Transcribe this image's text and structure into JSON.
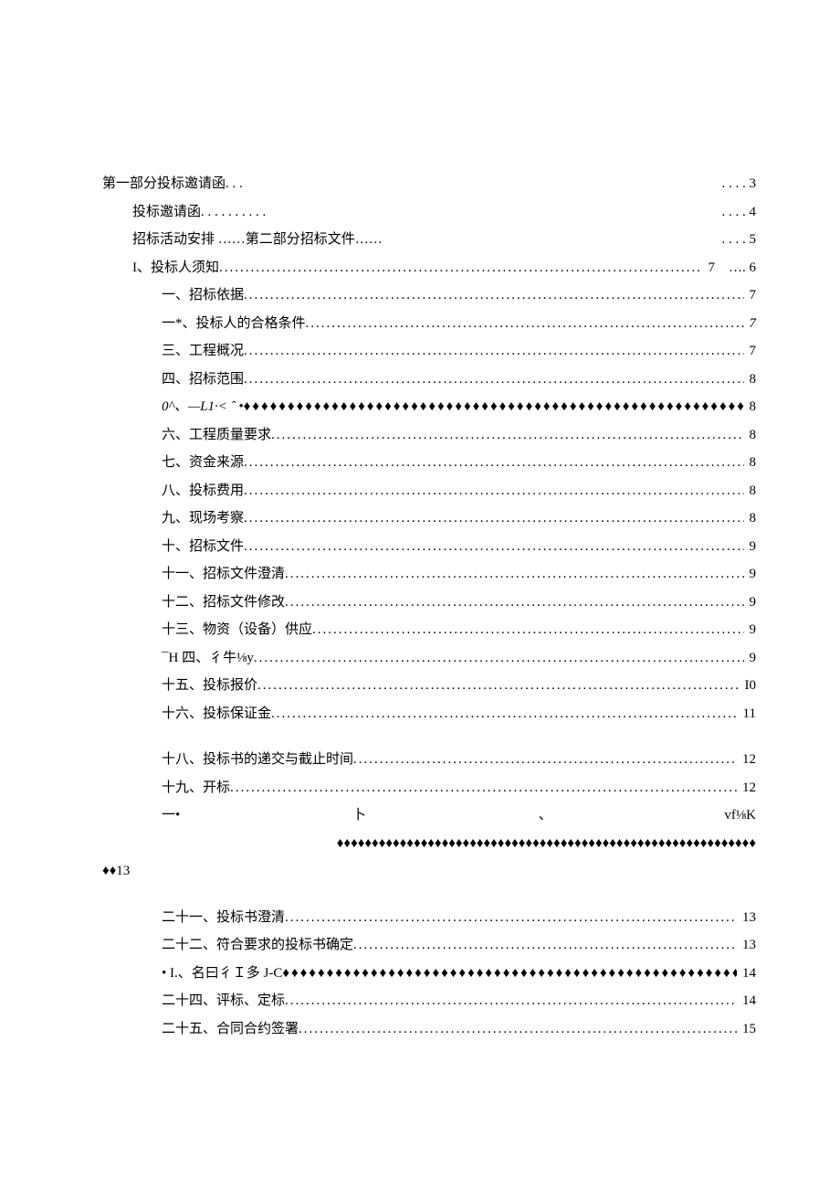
{
  "toc": [
    {
      "indent": 0,
      "label": "第一部分投标邀请函. . .",
      "leader": "",
      "page": ". . . . 3"
    },
    {
      "indent": 1,
      "label": "投标邀请函. . . . . . . . . .",
      "leader": "",
      "page": ". . . . 4"
    },
    {
      "indent": 1,
      "label": "招标活动安排 ……第二部分招标文件……",
      "leader": "",
      "page": ". . . . 5"
    },
    {
      "indent": 2,
      "label": "I、投标人须知 ",
      "leader": ".",
      "page": "7　…. 6"
    },
    {
      "indent": 3,
      "label": "一、招标依据 ",
      "leader": ".",
      "page": "7"
    },
    {
      "indent": 3,
      "label": "一*、投标人的合格条件 ",
      "leader": ".",
      "page": "7",
      "pageItalic": true
    },
    {
      "indent": 3,
      "label": "三、工程概况 ",
      "leader": ".",
      "page": "7"
    },
    {
      "indent": 3,
      "label": "四、招标范围 ",
      "leader": ".",
      "page": "8"
    },
    {
      "indent": 3,
      "label": "0^、—L1·< ˆ •",
      "labelItalic": true,
      "leader": "♦",
      "page": "8"
    },
    {
      "indent": 3,
      "label": "六、工程质量要求 ",
      "leader": ".",
      "page": "8"
    },
    {
      "indent": 3,
      "label": "七、资金来源 ",
      "leader": ".",
      "page": "8"
    },
    {
      "indent": 3,
      "label": "八、投标费用 ",
      "leader": ".",
      "page": "8"
    },
    {
      "indent": 3,
      "label": "九、现场考察 ",
      "leader": ".",
      "page": "8"
    },
    {
      "indent": 3,
      "label": "十、招标文件 ",
      "leader": ".",
      "page": "9"
    },
    {
      "indent": 3,
      "label": "十一、招标文件澄清 ",
      "leader": ".",
      "page": "9"
    },
    {
      "indent": 3,
      "label": "十二、招标文件修改 ",
      "leader": ".",
      "page": "9"
    },
    {
      "indent": 3,
      "label": "十三、物资（设备）供应 ",
      "leader": ".",
      "page": "9"
    },
    {
      "indent": 3,
      "label": "¯H 四、彳牛⅛y ",
      "leader": ".",
      "page": "9"
    },
    {
      "indent": 3,
      "label": "十五、投标报价 ",
      "leader": ".",
      "page": "I0"
    },
    {
      "indent": 3,
      "label": "十六、投标保证金 ",
      "leader": ".",
      "page": "11"
    },
    {
      "gap": true
    },
    {
      "indent": 3,
      "label": "十八、投标书的递交与截止时间 ",
      "leader": ".",
      "page": "12"
    },
    {
      "indent": 3,
      "label": "十九、开标 ",
      "leader": ".",
      "page": "12"
    },
    {
      "special": "twenty"
    },
    {
      "gap": true
    },
    {
      "indent": 3,
      "label": "二十一、投标书澄清 ",
      "leader": ".",
      "page": "13"
    },
    {
      "indent": 3,
      "label": "二十二、符合要求的投标书确定 ",
      "leader": ".",
      "page": "13"
    },
    {
      "indent": 3,
      "label": "   • I.、名曰彳Ｉ多 J-C",
      "leader": "♦",
      "page": "14"
    },
    {
      "indent": 3,
      "label": "二十四、评标、定标 ",
      "leader": ".",
      "page": "14"
    },
    {
      "indent": 3,
      "label": "二十五、合同合约签署 ",
      "leader": ".",
      "page": "15"
    }
  ],
  "twenty": {
    "line1_a": "一•",
    "line1_b": "卜",
    "line1_c": "、",
    "line1_d": "vf⅛K",
    "prefix": "♦♦13"
  }
}
